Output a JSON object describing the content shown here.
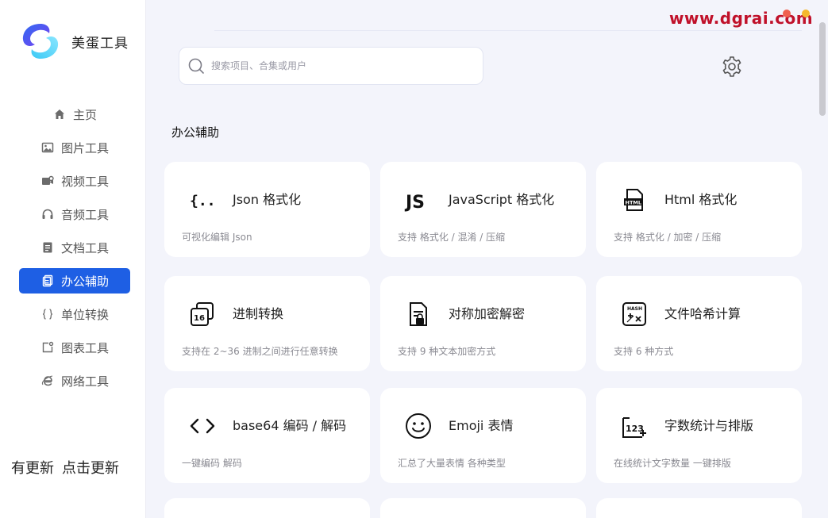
{
  "app": {
    "name": "美蛋工具"
  },
  "watermark": "www.dgrai.com",
  "search": {
    "placeholder": "搜索项目、合集或用户",
    "value": ""
  },
  "sidebar": {
    "items": [
      {
        "label": "主页",
        "icon": "home-icon",
        "active": false
      },
      {
        "label": "图片工具",
        "icon": "image-icon",
        "active": false
      },
      {
        "label": "视频工具",
        "icon": "video-icon",
        "active": false
      },
      {
        "label": "音频工具",
        "icon": "headphones-icon",
        "active": false
      },
      {
        "label": "文档工具",
        "icon": "document-icon",
        "active": false
      },
      {
        "label": "办公辅助",
        "icon": "office-icon",
        "active": true
      },
      {
        "label": "单位转换",
        "icon": "braces-icon",
        "active": false
      },
      {
        "label": "图表工具",
        "icon": "chart-icon",
        "active": false
      },
      {
        "label": "网络工具",
        "icon": "browser-icon",
        "active": false
      }
    ],
    "update_left": "有更新",
    "update_right": "点击更新"
  },
  "main": {
    "section_title": "办公辅助",
    "cards": [
      {
        "title": "Json 格式化",
        "desc": "可视化编辑 Json",
        "icon": "json-icon"
      },
      {
        "title": "JavaScript 格式化",
        "desc": "支持 格式化 / 混淆 / 压缩",
        "icon": "javascript-icon"
      },
      {
        "title": "Html 格式化",
        "desc": "支持 格式化 / 加密 / 压缩",
        "icon": "html-icon"
      },
      {
        "title": "进制转换",
        "desc": "支持在 2~36 进制之间进行任意转换",
        "icon": "base-convert-icon"
      },
      {
        "title": "对称加密解密",
        "desc": "支持 9 种文本加密方式",
        "icon": "encrypt-icon"
      },
      {
        "title": "文件哈希计算",
        "desc": "支持 6 种方式",
        "icon": "hash-icon"
      },
      {
        "title": "base64 编码 / 解码",
        "desc": "一键编码 解码",
        "icon": "code-brackets-icon"
      },
      {
        "title": "Emoji 表情",
        "desc": "汇总了大量表情  各种类型",
        "icon": "emoji-icon"
      },
      {
        "title": "字数统计与排版",
        "desc": "在线统计文字数量 一键排版",
        "icon": "word-count-icon"
      }
    ]
  }
}
